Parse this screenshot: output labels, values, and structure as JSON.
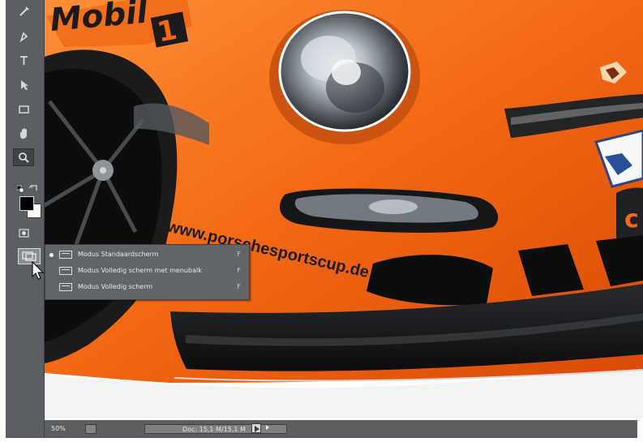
{
  "tools": [
    {
      "name": "eyedropper",
      "icon": "eyedropper-icon",
      "glyph": "✎"
    },
    {
      "name": "pen",
      "icon": "pen-icon",
      "glyph": "✒"
    },
    {
      "name": "type",
      "icon": "type-icon",
      "glyph": "T"
    },
    {
      "name": "path-selection",
      "icon": "path-selection-icon",
      "glyph": "⬉"
    },
    {
      "name": "rectangle",
      "icon": "rectangle-icon",
      "glyph": "▭"
    },
    {
      "name": "hand",
      "icon": "hand-icon",
      "glyph": "✋"
    },
    {
      "name": "zoom",
      "icon": "zoom-icon",
      "glyph": "🔍"
    }
  ],
  "colors": {
    "foreground": "#000000",
    "background": "#ffffff",
    "toolbar": "#5b5f63",
    "menu": "#616569",
    "car": "#f46a14"
  },
  "screen_mode_menu": {
    "items": [
      {
        "label": "Modus Standaardscherm",
        "shortcut": "F",
        "selected": true
      },
      {
        "label": "Modus Volledig scherm met menubalk",
        "shortcut": "F",
        "selected": false
      },
      {
        "label": "Modus Volledig scherm",
        "shortcut": "F",
        "selected": false
      }
    ]
  },
  "canvas": {
    "brand_logo": "Mobil 1",
    "website": "www.porschesportscup.de"
  },
  "statusbar": {
    "zoom": "50%",
    "doc": "Doc: 15,1 M/15,1 M"
  }
}
